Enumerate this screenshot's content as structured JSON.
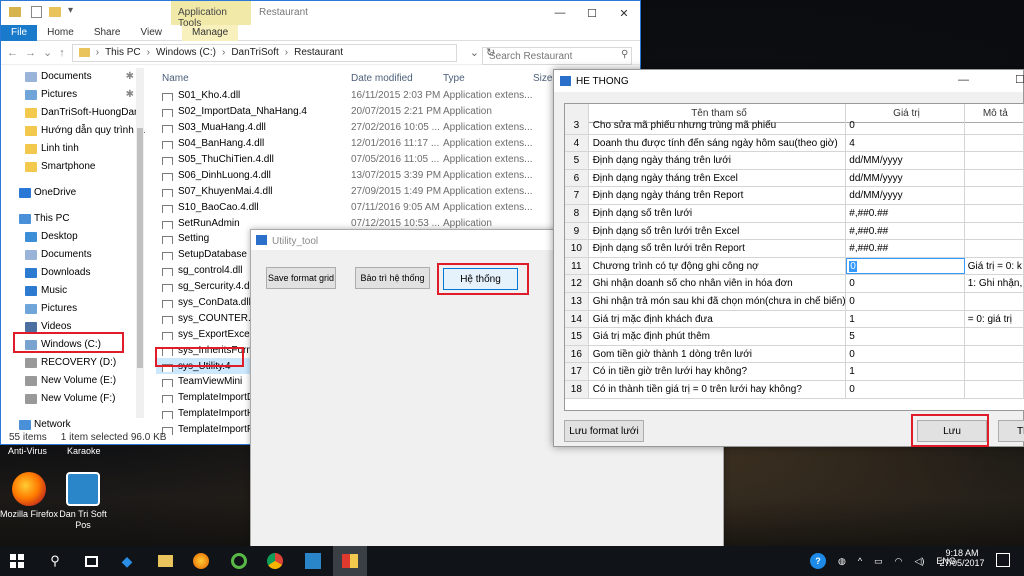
{
  "explorer": {
    "ribbon_context": "Application Tools",
    "title": "Restaurant",
    "tabs": [
      "File",
      "Home",
      "Share",
      "View",
      "Manage"
    ],
    "path": [
      "This PC",
      "Windows (C:)",
      "DanTriSoft",
      "Restaurant"
    ],
    "search_placeholder": "Search Restaurant",
    "columns": {
      "name": "Name",
      "date": "Date modified",
      "type": "Type",
      "size": "Size"
    },
    "nav": [
      {
        "label": "Documents",
        "pin": true,
        "lvl": 1,
        "color": "#9ab3d8"
      },
      {
        "label": "Pictures",
        "pin": true,
        "lvl": 1,
        "color": "#6fa5d8"
      },
      {
        "label": "DanTriSoft-HuongDan",
        "lvl": 1,
        "color": "#f2c94c"
      },
      {
        "label": "Hướng dẫn quy trình tá",
        "lvl": 1,
        "color": "#f2c94c"
      },
      {
        "label": "Linh tinh",
        "lvl": 1,
        "color": "#f2c94c"
      },
      {
        "label": "Smartphone",
        "lvl": 1,
        "color": "#f2c94c"
      },
      {
        "label": "",
        "lvl": 1,
        "color": ""
      },
      {
        "label": "OneDrive",
        "lvl": 0,
        "color": "#2b78d6"
      },
      {
        "label": "",
        "lvl": 1,
        "color": ""
      },
      {
        "label": "This PC",
        "lvl": 0,
        "color": "#4a90d9"
      },
      {
        "label": "Desktop",
        "lvl": 1,
        "color": "#3c8ed8"
      },
      {
        "label": "Documents",
        "lvl": 1,
        "color": "#9ab3d8"
      },
      {
        "label": "Downloads",
        "lvl": 1,
        "color": "#2d7bd0"
      },
      {
        "label": "Music",
        "lvl": 1,
        "color": "#2d7bd0"
      },
      {
        "label": "Pictures",
        "lvl": 1,
        "color": "#6fa5d8"
      },
      {
        "label": "Videos",
        "lvl": 1,
        "color": "#4a6fa0"
      },
      {
        "label": "Windows (C:)",
        "lvl": 1,
        "color": "#7aa4d0"
      },
      {
        "label": "RECOVERY (D:)",
        "lvl": 1,
        "color": "#999"
      },
      {
        "label": "New Volume (E:)",
        "lvl": 1,
        "color": "#999"
      },
      {
        "label": "New Volume (F:)",
        "lvl": 1,
        "color": "#999"
      },
      {
        "label": "",
        "lvl": 1,
        "color": ""
      },
      {
        "label": "Network",
        "lvl": 0,
        "color": "#4a90d9"
      }
    ],
    "files": [
      {
        "name": "S01_Kho.4.dll",
        "date": "16/11/2015 2:03 PM",
        "type": "Application extens..."
      },
      {
        "name": "S02_ImportData_NhaHang.4",
        "date": "20/07/2015 2:21 PM",
        "type": "Application"
      },
      {
        "name": "S03_MuaHang.4.dll",
        "date": "27/02/2016 10:05 ...",
        "type": "Application extens..."
      },
      {
        "name": "S04_BanHang.4.dll",
        "date": "12/01/2016 11:17 ...",
        "type": "Application extens..."
      },
      {
        "name": "S05_ThuChiTien.4.dll",
        "date": "07/05/2016 11:05 ...",
        "type": "Application extens..."
      },
      {
        "name": "S06_DinhLuong.4.dll",
        "date": "13/07/2015 3:39 PM",
        "type": "Application extens..."
      },
      {
        "name": "S07_KhuyenMai.4.dll",
        "date": "27/09/2015 1:49 PM",
        "type": "Application extens..."
      },
      {
        "name": "S10_BaoCao.4.dll",
        "date": "07/11/2016 9:05 AM",
        "type": "Application extens..."
      },
      {
        "name": "SetRunAdmin",
        "date": "07/12/2015 10:53 ...",
        "type": "Application"
      },
      {
        "name": "Setting",
        "date": "",
        "type": ""
      },
      {
        "name": "SetupDatabase",
        "date": "",
        "type": ""
      },
      {
        "name": "sg_control4.dll",
        "date": "",
        "type": ""
      },
      {
        "name": "sg_Sercurity.4.dll",
        "date": "",
        "type": ""
      },
      {
        "name": "sys_ConData.dll",
        "date": "",
        "type": ""
      },
      {
        "name": "sys_COUNTER.4.dl",
        "date": "",
        "type": ""
      },
      {
        "name": "sys_ExportExcel.2.d",
        "date": "",
        "type": ""
      },
      {
        "name": "sys_InheritsForm.4.",
        "date": "",
        "type": ""
      },
      {
        "name": "sys_Utility.4",
        "date": "",
        "type": "",
        "sel": true
      },
      {
        "name": "TeamViewMini",
        "date": "",
        "type": ""
      },
      {
        "name": "TemplateImportD",
        "date": "",
        "type": ""
      },
      {
        "name": "TemplateImportH",
        "date": "",
        "type": ""
      },
      {
        "name": "TemplateImportPl",
        "date": "",
        "type": ""
      }
    ],
    "status_items": "55 items",
    "status_selected": "1 item selected  96.0 KB"
  },
  "utility": {
    "title": "Utility_tool",
    "btn_save_format": "Save format grid",
    "btn_maintenance": "Bảo trì hệ thống",
    "btn_system": "Hệ thống"
  },
  "he_thong": {
    "title": "HE THONG",
    "headers": [
      "Tên tham số",
      "Giá trị",
      "Mô tả"
    ],
    "rows": [
      {
        "n": "3",
        "name": "Cho sửa mã phiếu nhưng trùng mã phiếu",
        "val": "0",
        "desc": ""
      },
      {
        "n": "4",
        "name": "Doanh thu được tính đến sáng ngày hôm sau(theo giờ)",
        "val": "4",
        "desc": ""
      },
      {
        "n": "5",
        "name": "Định dạng ngày tháng trên lưới",
        "val": "dd/MM/yyyy",
        "desc": ""
      },
      {
        "n": "6",
        "name": "Định dạng ngày tháng trên Excel",
        "val": "dd/MM/yyyy",
        "desc": ""
      },
      {
        "n": "7",
        "name": "Định dạng ngày tháng trên Report",
        "val": "dd/MM/yyyy",
        "desc": ""
      },
      {
        "n": "8",
        "name": "Định dạng số trên lưới",
        "val": "#,##0.##",
        "desc": ""
      },
      {
        "n": "9",
        "name": "Định dạng số trên lưới trên Excel",
        "val": "#,##0.##",
        "desc": ""
      },
      {
        "n": "10",
        "name": "Định dạng số trên lưới trên Report",
        "val": "#,##0.##",
        "desc": ""
      },
      {
        "n": "11",
        "name": "Chương trình có tự động ghi công nợ",
        "val": "0",
        "desc": "Giá trị = 0: k",
        "edit": true
      },
      {
        "n": "12",
        "name": "Ghi nhận doanh số cho nhân viên in hóa đơn",
        "val": "0",
        "desc": "1: Ghi nhận,"
      },
      {
        "n": "13",
        "name": "Ghi nhận trả món sau khi đã chọn món(chưa in chế biến)",
        "val": "0",
        "desc": ""
      },
      {
        "n": "14",
        "name": "Giá trị mặc định khách đưa",
        "val": "1",
        "desc": " = 0: giá trị"
      },
      {
        "n": "15",
        "name": "Giá trị mặc định phút thêm",
        "val": "5",
        "desc": ""
      },
      {
        "n": "16",
        "name": "Gom tiền giờ thành 1 dòng trên lưới",
        "val": "0",
        "desc": ""
      },
      {
        "n": "17",
        "name": "Có in tiền giờ trên lưới hay không?",
        "val": "1",
        "desc": ""
      },
      {
        "n": "18",
        "name": "Có in thành tiền giá trị = 0 trên lưới hay không?",
        "val": "0",
        "desc": ""
      }
    ],
    "btn_save_grid": "Lưu format lưới",
    "btn_save": "Lưu",
    "btn_exit": "Th"
  },
  "desktop": {
    "labels_top": [
      "Anti-Virus",
      "Karaoke"
    ],
    "icons": [
      {
        "label": "Mozilla Firefox",
        "color": "#e66000"
      },
      {
        "label": "Dan Tri Soft Pos",
        "color": "#2a86c8"
      }
    ]
  },
  "taskbar": {
    "time": "9:18 AM",
    "date": "27/05/2017",
    "lang": "ENG"
  }
}
